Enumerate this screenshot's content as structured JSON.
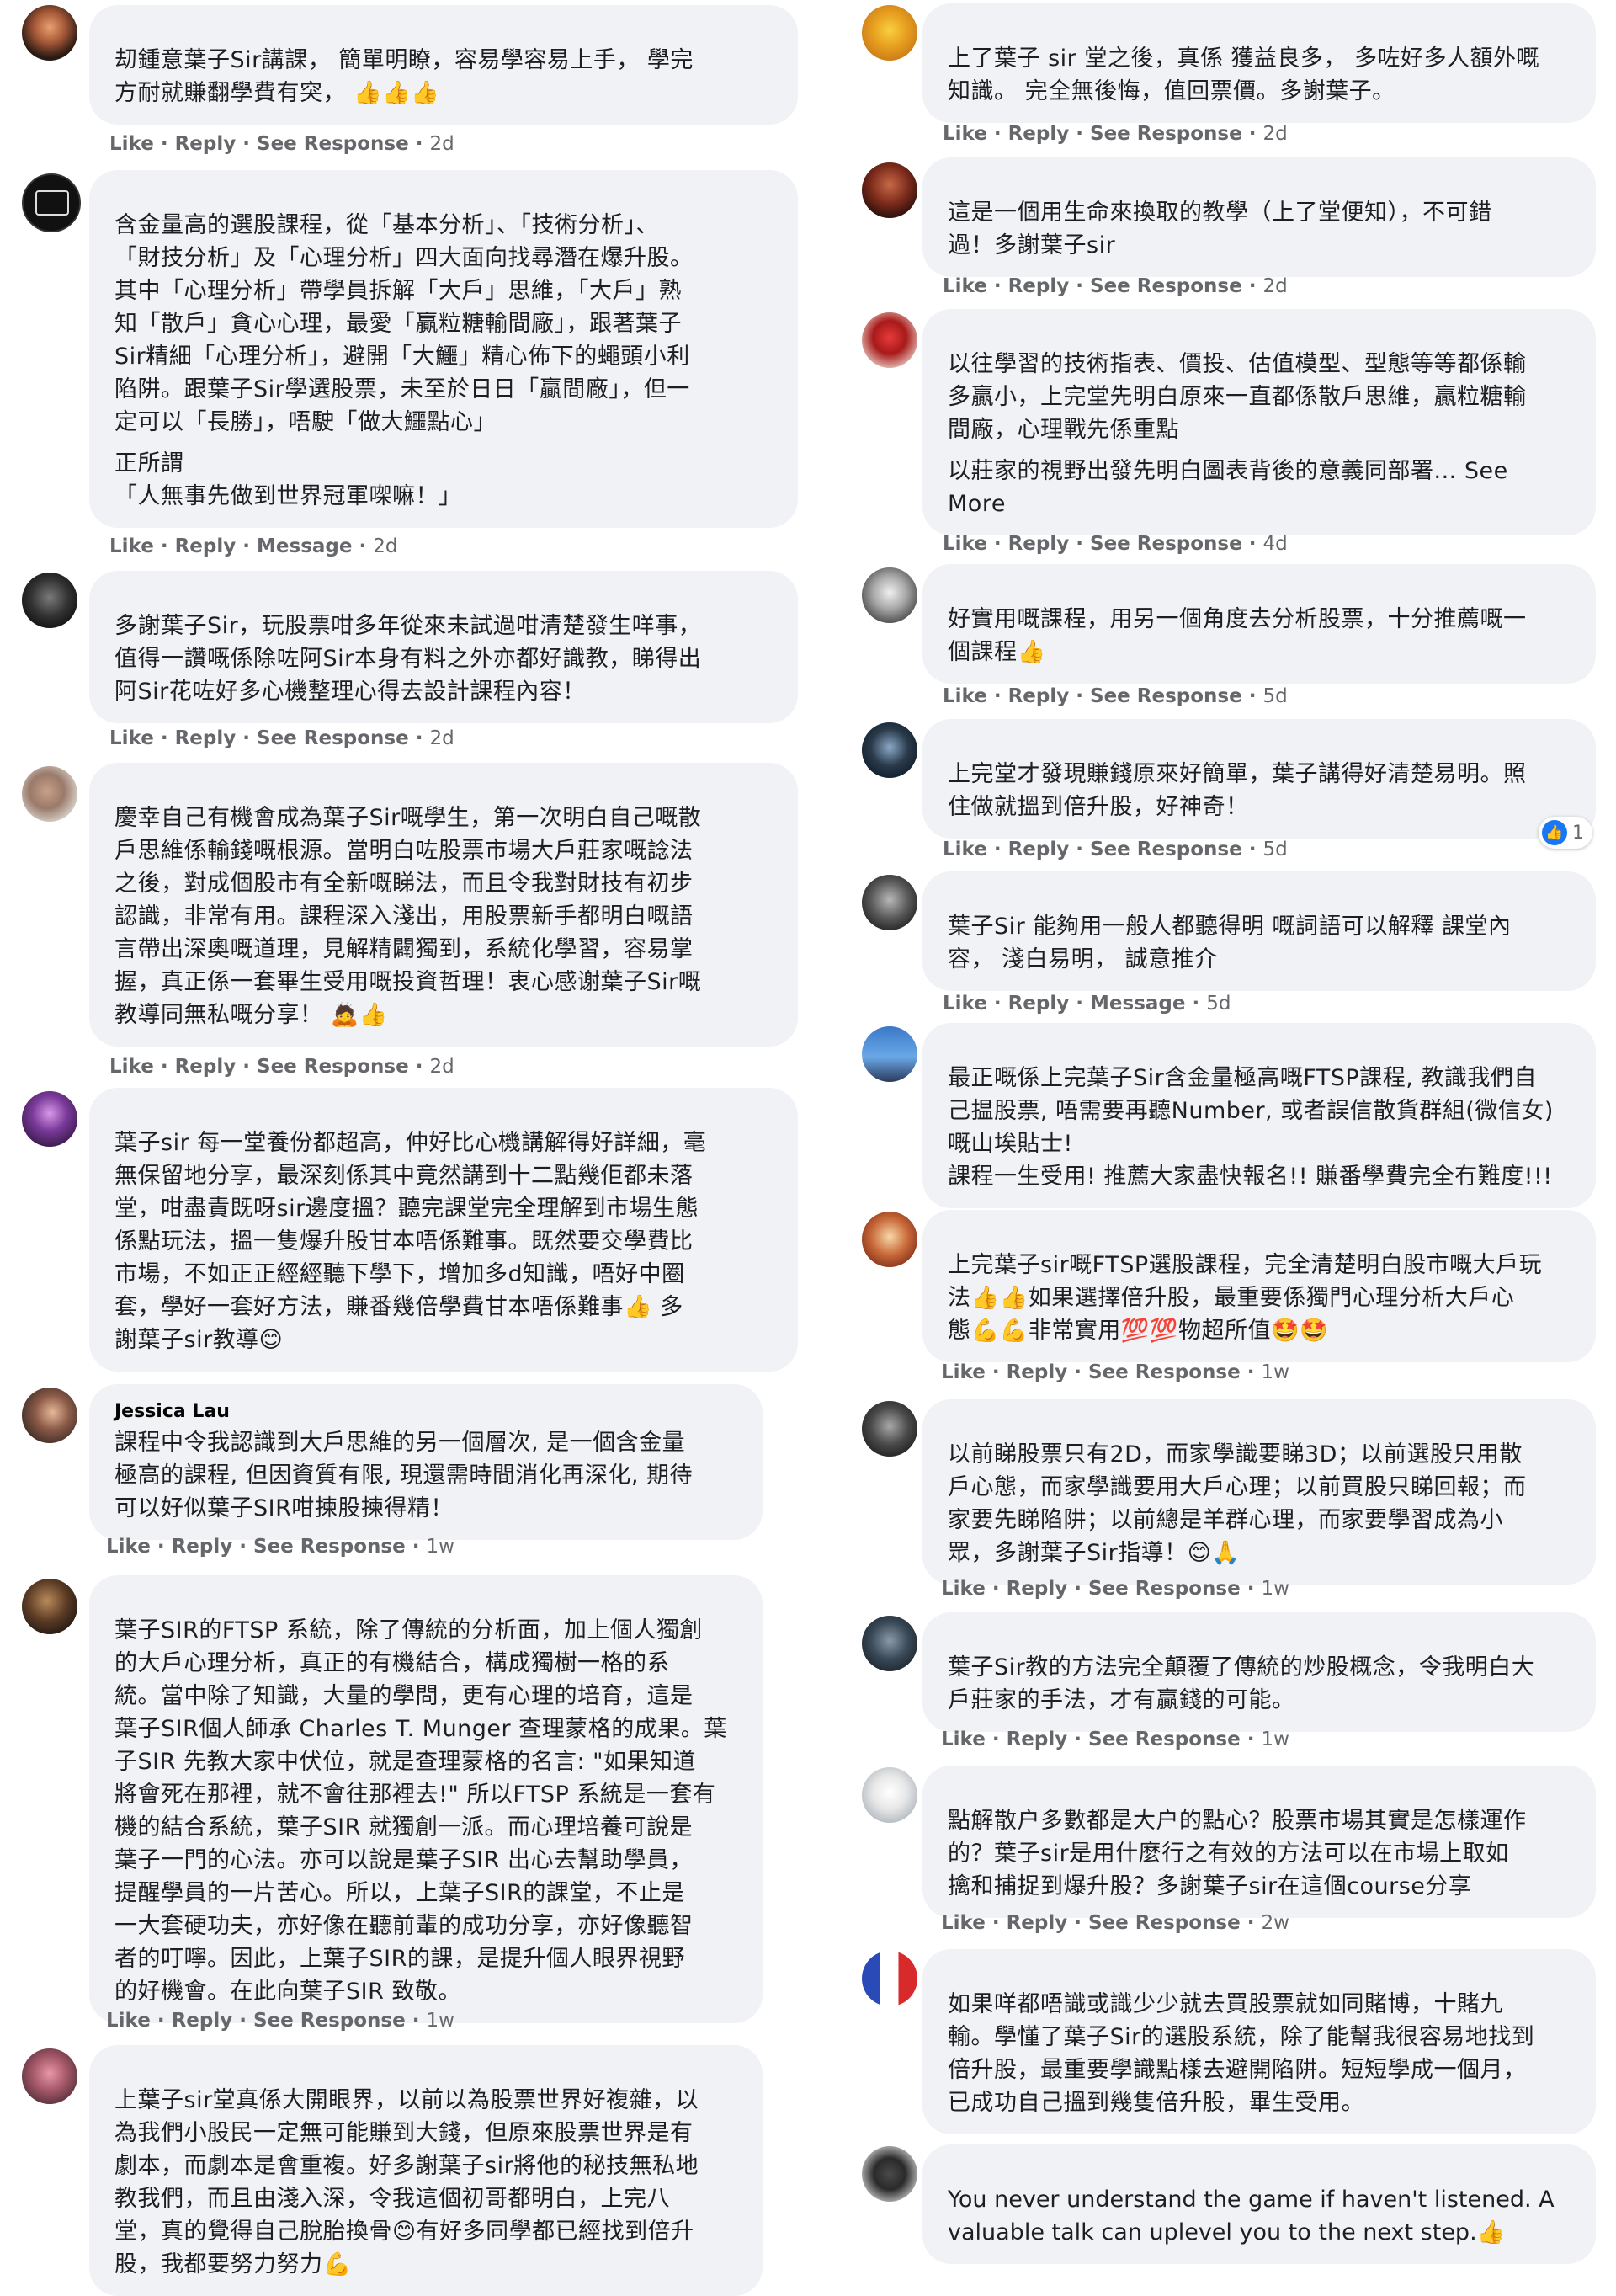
{
  "actions": {
    "like": "Like",
    "reply": "Reply",
    "see_response": "See Response",
    "message": "Message",
    "sep": " · "
  },
  "comments": [
    {
      "name": "",
      "paragraphs": [
        "刧鍾意葉子Sir講課， 簡單明瞭，容易學容易上手， 學完\n方耐就賺翻學費有突， 👍👍👍"
      ],
      "second": "See Response",
      "time": "2d"
    },
    {
      "name": "",
      "paragraphs": [
        "含金量高的選股課程，從「基本分析」、「技術分析」、\n「財技分析」及「心理分析」四大面向找尋潛在爆升股。\n其中「心理分析」帶學員拆解「大戶」思維，「大戶」熟\n知「散戶」貪心心理，最愛「贏粒糖輸間廠」，跟著葉子\nSir精細「心理分析」，避開「大鱷」精心佈下的蠅頭小利\n陷阱。跟葉子Sir學選股票，未至於日日「贏間廠」，但一\n定可以「長勝」，唔駛「做大鱷點心」",
        "正所謂\n「人無事先做到世界冠軍㗎嘛！」"
      ],
      "second": "Message",
      "time": "2d"
    },
    {
      "name": "",
      "paragraphs": [
        "多謝葉子Sir，玩股票咁多年從來未試過咁清楚發生咩事，\n值得一讚嘅係除咗阿Sir本身有料之外亦都好識教，睇得出\n阿Sir花咗好多心機整理心得去設計課程內容！"
      ],
      "second": "See Response",
      "time": "2d"
    },
    {
      "name": "",
      "paragraphs": [
        "慶幸自己有機會成為葉子Sir嘅學生，第一次明白自己嘅散\n戶思維係輸錢嘅根源。當明白咗股票市場大戶莊家嘅諗法\n之後，對成個股市有全新嘅睇法，而且令我對財技有初步\n認識，非常有用。課程深入淺出，用股票新手都明白嘅語\n言帶出深奧嘅道理，見解精闢獨到，系統化學習，容易掌\n握，真正係一套畢生受用嘅投資哲理！衷心感谢葉子Sir嘅\n教導同無私嘅分享！ 🙇👍"
      ],
      "second": "See Response",
      "time": "2d"
    },
    {
      "name": "",
      "paragraphs": [
        "葉子sir 每一堂養份都超高，仲好比心機講解得好詳細，毫\n無保留地分享，最深刻係其中竟然講到十二點幾佢都未落\n堂，咁盡責既呀sir邊度搵？聽完課堂完全理解到市場生態\n係點玩法，搵一隻爆升股甘本唔係難事。既然要交學費比\n市場，不如正正經經聽下學下，增加多d知識，唔好中圈\n套，學好一套好方法，賺番幾倍學費甘本唔係難事👍 多\n謝葉子sir教導😊"
      ],
      "second": "See Response",
      "time": ""
    },
    {
      "name": "Jessica Lau",
      "paragraphs": [
        "課程中令我認識到大戶思維的另一個層次, 是一個含金量\n極高的課程, 但因資質有限, 現還需時間消化再深化, 期待\n可以好似葉子SIR咁揀股揀得精！"
      ],
      "second": "See Response",
      "time": "1w"
    },
    {
      "name": "",
      "paragraphs": [
        "葉子SIR的FTSP 系統，除了傳統的分析面，加上個人獨創\n的大戶心理分析，真正的有機結合，構成獨樹一格的系\n統。當中除了知識，大量的學問，更有心理的培育，這是\n葉子SIR個人師承 Charles T. Munger 查理蒙格的成果。葉\n子SIR 先教大家中伏位，就是查理蒙格的名言: \"如果知道\n將會死在那裡，就不會往那裡去!\" 所以FTSP 系統是一套有\n機的結合系統，葉子SIR 就獨創一派。而心理培養可說是\n葉子一門的心法。亦可以說是葉子SIR 出心去幫助學員，\n提醒學員的一片苦心。所以，上葉子SIR的課堂，不止是\n一大套硬功夫，亦好像在聽前輩的成功分享，亦好像聽智\n者的叮嚀。因此，上葉子SIR的課，是提升個人眼界視野\n的好機會。在此向葉子SIR 致敬。"
      ],
      "second": "See Response",
      "time": "1w"
    },
    {
      "name": "",
      "paragraphs": [
        "上葉子sir堂真係大開眼界，以前以為股票世界好複雜，以\n為我們小股民一定無可能賺到大錢，但原來股票世界是有\n劇本，而劇本是會重複。好多謝葉子sir將他的秘技無私地\n教我們，而且由淺入深，令我這個初哥都明白，上完八\n堂，真的覺得自己脫胎換骨😊有好多同學都已經找到倍升\n股，我都要努力努力💪"
      ]
    },
    {
      "name": "",
      "paragraphs": [
        "上了葉子 sir 堂之後，真係 獲益良多， 多咗好多人額外嘅\n知識。 完全無後悔，值回票價。多謝葉子。"
      ],
      "second": "See Response",
      "time": "2d"
    },
    {
      "name": "",
      "paragraphs": [
        "這是一個用生命來換取的教學（上了堂便知），不可錯\n過！多謝葉子sir"
      ],
      "second": "See Response",
      "time": "2d"
    },
    {
      "name": "",
      "paragraphs": [
        "以往學習的技術指表、價投、估值模型、型態等等都係輸\n多贏小，上完堂先明白原來一直都係散戶思維，贏粒糖輸\n間廠，心理戰先係重點",
        "以莊家的視野出發先明白圖表背後的意義同部署... See\nMore"
      ],
      "second": "See Response",
      "time": "4d"
    },
    {
      "name": "",
      "paragraphs": [
        "好實用嘅課程，用另一個角度去分析股票，十分推薦嘅一\n個課程👍"
      ],
      "second": "See Response",
      "time": "5d"
    },
    {
      "name": "",
      "paragraphs": [
        "上完堂才發現賺錢原來好簡單，葉子講得好清楚易明。照\n住做就搵到倍升股，好神奇！"
      ],
      "second": "See Response",
      "time": "5d",
      "reactions": "1"
    },
    {
      "name": "",
      "paragraphs": [
        "葉子Sir 能夠用一般人都聽得明 嘅詞語可以解釋 課堂內\n容， 淺白易明， 誠意推介"
      ],
      "second": "Message",
      "time": "5d"
    },
    {
      "name": "",
      "paragraphs": [
        "最正嘅係上完葉子Sir含金量極高嘅FTSP課程, 教識我們自\n己揾股票, 唔需要再聽Number, 或者誤信散貨群組(微信女)\n嘅山埃貼士!\n課程一生受用! 推薦大家盡快報名!! 賺番學費完全冇難度!!!"
      ]
    },
    {
      "name": "",
      "paragraphs": [
        "上完葉子sir嘅FTSP選股課程，完全清楚明白股市嘅大戶玩\n法👍👍如果選擇倍升股，最重要係獨門心理分析大戶心\n態💪💪非常實用💯💯物超所值🤩🤩"
      ],
      "second": "See Response",
      "time": "1w"
    },
    {
      "name": "",
      "paragraphs": [
        "以前睇股票只有2D，而家學識要睇3D；以前選股只用散\n戶心態，而家學識要用大戶心理；以前買股只睇回報；而\n家要先睇陷阱；以前總是羊群心理，而家要學習成為小\n眾，多謝葉子Sir指導！😊🙏"
      ],
      "second": "See Response",
      "time": "1w"
    },
    {
      "name": "",
      "paragraphs": [
        "葉子Sir教的方法完全顛覆了傳統的炒股概念，令我明白大\n戶莊家的手法，才有贏錢的可能。"
      ],
      "second": "See Response",
      "time": "1w"
    },
    {
      "name": "",
      "paragraphs": [
        "點解散户多數都是大户的點心？股票市場其實是怎樣運作\n的？葉子sir是用什麼行之有效的方法可以在市場上取如\n擒和捕捉到爆升股？多謝葉子sir在這個course分享"
      ],
      "second": "See Response",
      "time": "2w"
    },
    {
      "name": "",
      "paragraphs": [
        "如果咩都唔識或識少少就去買股票就如同賭博，十賭九\n輸。學懂了葉子Sir的選股系統，除了能幫我很容易地找到\n倍升股，最重要學識點樣去避開陷阱。短短學成一個月，\n已成功自己搵到幾隻倍升股，畢生受用。"
      ]
    },
    {
      "name": "",
      "paragraphs": [
        "You never understand the game if haven't listened. A\nvaluable talk can uplevel you to the next step.👍"
      ]
    }
  ]
}
